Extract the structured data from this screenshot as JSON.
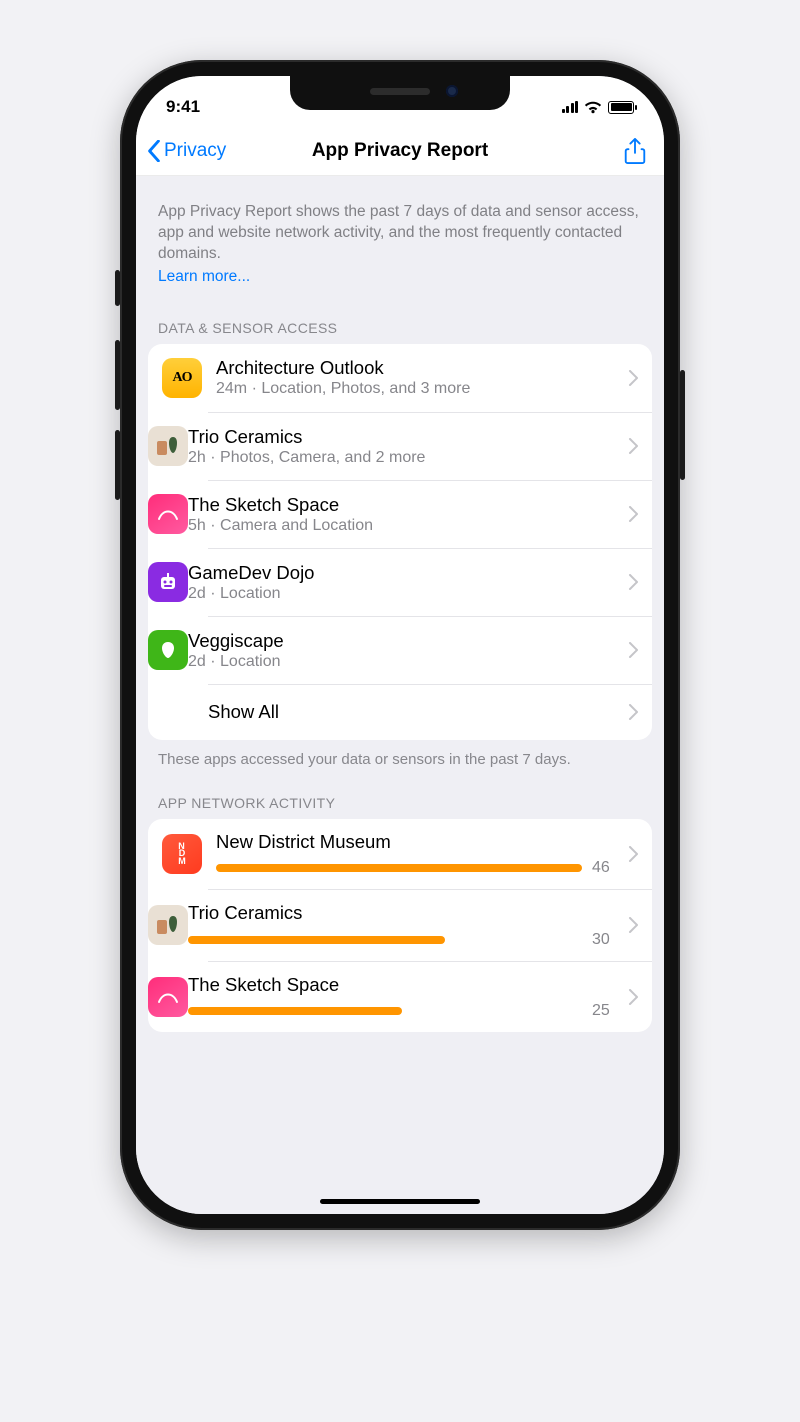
{
  "status": {
    "time": "9:41"
  },
  "nav": {
    "back_label": "Privacy",
    "title": "App Privacy Report"
  },
  "intro": {
    "text": "App Privacy Report shows the past 7 days of data and sensor access, app and website network activity, and the most frequently contacted domains.",
    "learn_more": "Learn more..."
  },
  "sections": {
    "data_sensor": {
      "header": "DATA & SENSOR ACCESS",
      "footer": "These apps accessed your data or sensors in the past 7 days.",
      "show_all": "Show All",
      "items": [
        {
          "name": "Architecture Outlook",
          "detail": "24m · Location, Photos, and 3 more",
          "icon": "ao"
        },
        {
          "name": "Trio Ceramics",
          "detail": "2h · Photos, Camera, and 2 more",
          "icon": "trio"
        },
        {
          "name": "The Sketch Space",
          "detail": "5h · Camera and Location",
          "icon": "sketch"
        },
        {
          "name": "GameDev Dojo",
          "detail": "2d · Location",
          "icon": "gamedev"
        },
        {
          "name": "Veggiscape",
          "detail": "2d · Location",
          "icon": "veg"
        }
      ]
    },
    "network": {
      "header": "APP NETWORK ACTIVITY",
      "max": 46,
      "items": [
        {
          "name": "New District Museum",
          "value": 46,
          "icon": "ndm"
        },
        {
          "name": "Trio Ceramics",
          "value": 30,
          "icon": "trio"
        },
        {
          "name": "The Sketch Space",
          "value": 25,
          "icon": "sketch"
        }
      ]
    }
  }
}
